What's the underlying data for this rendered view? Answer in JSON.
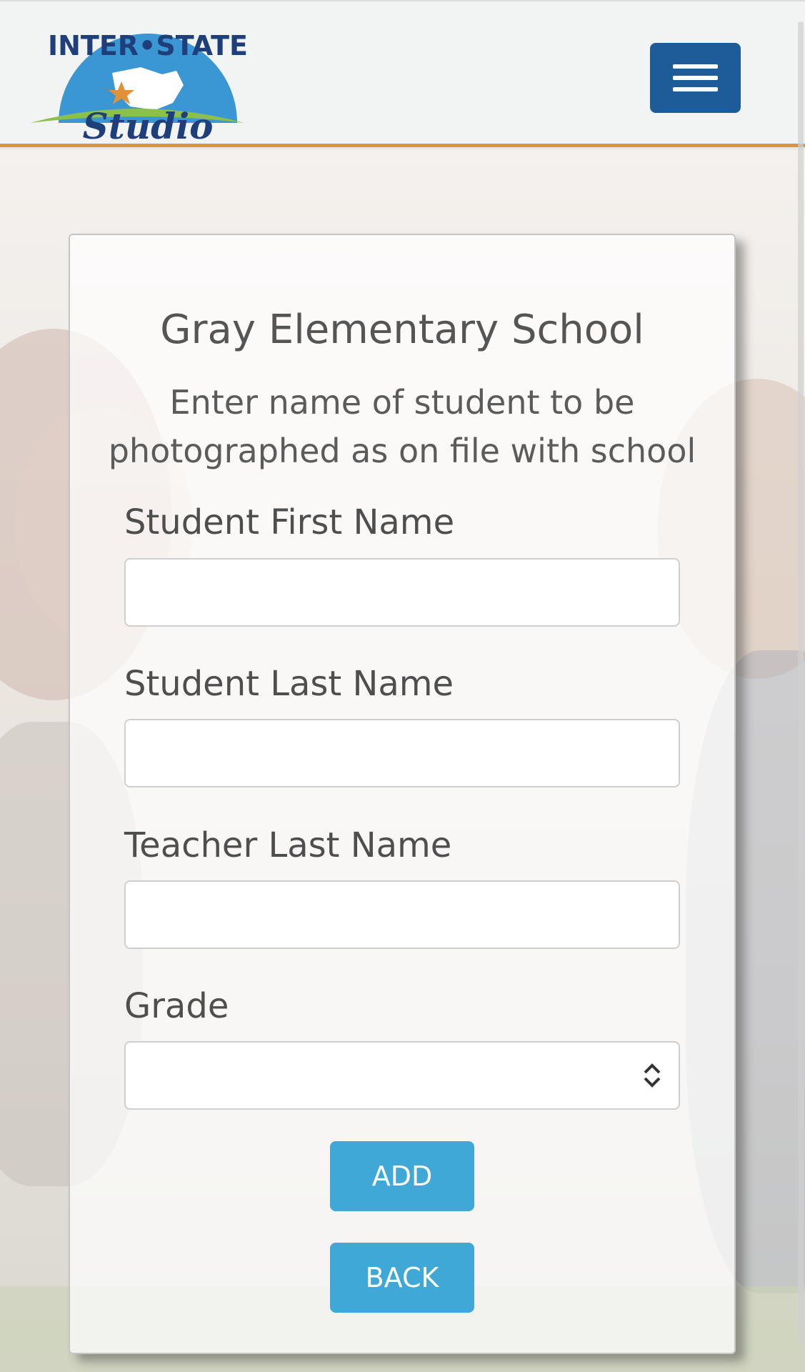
{
  "brand": {
    "logo_text_top": "INTER•STATE",
    "logo_text_bottom": "Studio",
    "colors": {
      "header_border": "#e0913a",
      "menu_button": "#1d5c99",
      "action_button": "#3fa8d6"
    }
  },
  "header": {
    "menu_icon": "hamburger-icon"
  },
  "form": {
    "title": "Gray Elementary School",
    "subtitle": "Enter name of student to be photographed as on file with school",
    "fields": [
      {
        "label": "Student First Name",
        "value": "",
        "placeholder": ""
      },
      {
        "label": "Student Last Name",
        "value": "",
        "placeholder": ""
      },
      {
        "label": "Teacher Last Name",
        "value": "",
        "placeholder": ""
      }
    ],
    "grade": {
      "label": "Grade",
      "value": ""
    },
    "add_label": "ADD",
    "back_label": "BACK"
  }
}
